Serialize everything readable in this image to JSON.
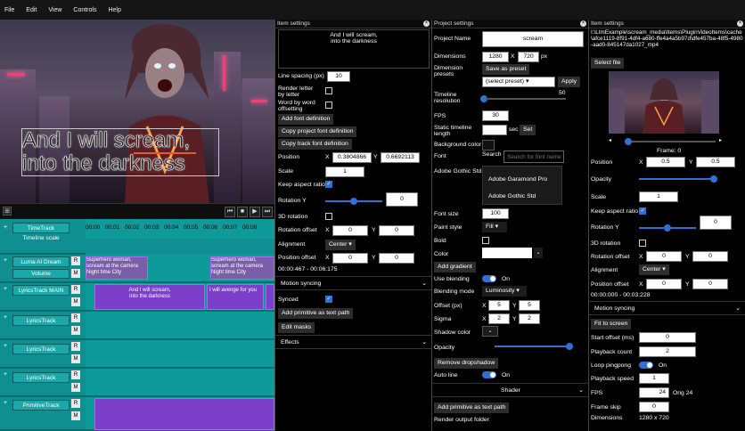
{
  "menu": [
    "File",
    "Edit",
    "View",
    "Controls",
    "Help"
  ],
  "video": {
    "caption_line1": "And I will scream,",
    "caption_line2": "into the darkness"
  },
  "transport": {
    "buttons": [
      "⏮",
      "■",
      "▶",
      "⏭"
    ]
  },
  "timeline": {
    "ruler": [
      "00:00",
      "00:01",
      "00:02",
      "00:03",
      "00:04",
      "00:05",
      "00:06",
      "00:07",
      "00:08"
    ],
    "tracks": [
      {
        "name": "TimeTrack",
        "sub": "Timeline scale"
      },
      {
        "name": "Luma AI Dream",
        "sub": "Volume"
      },
      {
        "name": "LyricsTrack MAIN"
      },
      {
        "name": "LyricsTrack"
      },
      {
        "name": "LyricsTrack"
      },
      {
        "name": "LyricsTrack"
      },
      {
        "name": "PrimitiveTrack"
      }
    ],
    "r_label": "R",
    "m_label": "M",
    "plus": "+",
    "clip_a_line1": "Superhero woman,",
    "clip_a_line2": "scream at the camera",
    "clip_a_line3": "Night time City",
    "clip_b_line1": "Superhero woman,",
    "clip_b_line2": "scream at the camera",
    "clip_b_line3": "Night time City",
    "lyric1_line1": "And I will scream,",
    "lyric1_line2": "into the darkness",
    "lyric2": "I will avenge for you"
  },
  "item1": {
    "header": "Item settings",
    "text_line1": "And I will scream,",
    "text_line2": "into the darkness",
    "line_spacing_label": "Line spacing (px)",
    "line_spacing": "10",
    "render_letter_label": "Render letter by letter",
    "word_by_word_label": "Word by word offsetting",
    "add_font_def": "Add font definition",
    "copy_project_font": "Copy project font definition",
    "copy_track_font": "Copy track font definition",
    "position_label": "Position",
    "pos_x": "0.3804866",
    "pos_y": "0.6692113",
    "scale_label": "Scale",
    "scale": "1",
    "keep_aspect_label": "Keep aspect ratio",
    "rotation_y_label": "Rotation Y",
    "rotation_y": "0",
    "rot3d_label": "3D rotation",
    "rot_offset_label": "Rotation offset",
    "rot_off_x": "0",
    "rot_off_y": "0",
    "alignment_label": "Alignment",
    "alignment": "Center",
    "pos_offset_label": "Position offset",
    "pos_off_x": "0",
    "pos_off_y": "0",
    "time_range": "00:00:467 - 00:06:175",
    "motion_sync": "Motion syncing",
    "synced_label": "Synced",
    "add_primitive": "Add primitive as text path",
    "edit_masks": "Edit masks",
    "effects": "Effects",
    "x_label": "X",
    "y_label": "Y"
  },
  "project": {
    "header": "Project settings",
    "name_label": "Project Name",
    "name": "scream",
    "dimensions_label": "Dimensions",
    "width": "1280",
    "height": "720",
    "px": "px",
    "presets_label": "Dimension presets",
    "save_preset": "Save as preset",
    "select_preset": "(select preset)",
    "apply": "Apply",
    "timeline_res_label": "Timeline resolution",
    "timeline_res": "50",
    "fps_label": "FPS",
    "fps": "30",
    "static_len_label": "Static timeline length",
    "sec": "sec",
    "set": "Set",
    "bg_color_label": "Background color",
    "font_label": "Font",
    "search_label": "Search",
    "search_placeholder": "Search for font name",
    "font_current": "Adobe Gothic Std",
    "font_options": [
      "Adobe Garamond Pro",
      "Adobe Gothic Std"
    ],
    "font_size_label": "Font size",
    "font_size": "100",
    "paint_style_label": "Paint style",
    "paint_style": "Fill",
    "bold_label": "Bold",
    "color_label": "Color",
    "add_gradient": "Add gradient",
    "use_blending_label": "Use blending",
    "on": "On",
    "blending_mode_label": "Blending mode",
    "blending_mode": "Luminosity",
    "offset_label": "Offset (px)",
    "off_x": "5",
    "off_y": "5",
    "sigma_label": "Sigma",
    "sig_x": "2",
    "sig_y": "2",
    "shadow_color_label": "Shadow color",
    "opacity_label": "Opacity",
    "remove_shadow": "Remove dropshadow",
    "auto_line_label": "Auto line",
    "shader": "Shader",
    "add_primitive": "Add primitive as text path",
    "render_output": "Render output folder",
    "x_label": "X",
    "y_label": "Y"
  },
  "item2": {
    "header": "Item settings",
    "path": "I:\\LtmExample\\scream_media\\Items\\PluginVideoItems\\cache\\afce1119-8f91-4df4-a680-ffe4a4a5b97d\\dfe457ba-48f5-4980-aad0-845147da1027_mp4",
    "select_file": "Select file",
    "frame": "Frame: 0",
    "position_label": "Position",
    "pos_x": "0.5",
    "pos_y": "0.5",
    "opacity_label": "Opacity",
    "scale_label": "Scale",
    "scale": "1",
    "keep_aspect_label": "Keep aspect ratio",
    "rotation_y_label": "Rotation Y",
    "rotation_y": "0",
    "rot3d_label": "3D rotation",
    "rot_offset_label": "Rotation offset",
    "rot_off_x": "0",
    "rot_off_y": "0",
    "alignment_label": "Alignment",
    "alignment": "Center",
    "pos_offset_label": "Position offset",
    "pos_off_x": "0",
    "pos_off_y": "0",
    "time_range": "00:00:000 - 00:03:228",
    "motion_sync": "Motion syncing",
    "fit_screen": "Fit to screen",
    "start_offset_label": "Start offset (ms)",
    "start_offset": "0",
    "playback_count_label": "Playback count",
    "playback_count": "2",
    "loop_label": "Loop pingpong",
    "on": "On",
    "playback_speed_label": "Playback speed",
    "playback_speed": "1",
    "fps_label": "FPS",
    "fps": "24",
    "orig": "Orig 24",
    "frame_skip_label": "Frame skip",
    "frame_skip": "0",
    "dimensions_label": "Dimensions",
    "dims": "1280  x  720",
    "x_label": "X",
    "y_label": "Y"
  },
  "colors": {
    "accent": "#2f6fd6",
    "track_bg": "#0f9a9a",
    "clip": "#7b3fc9"
  }
}
